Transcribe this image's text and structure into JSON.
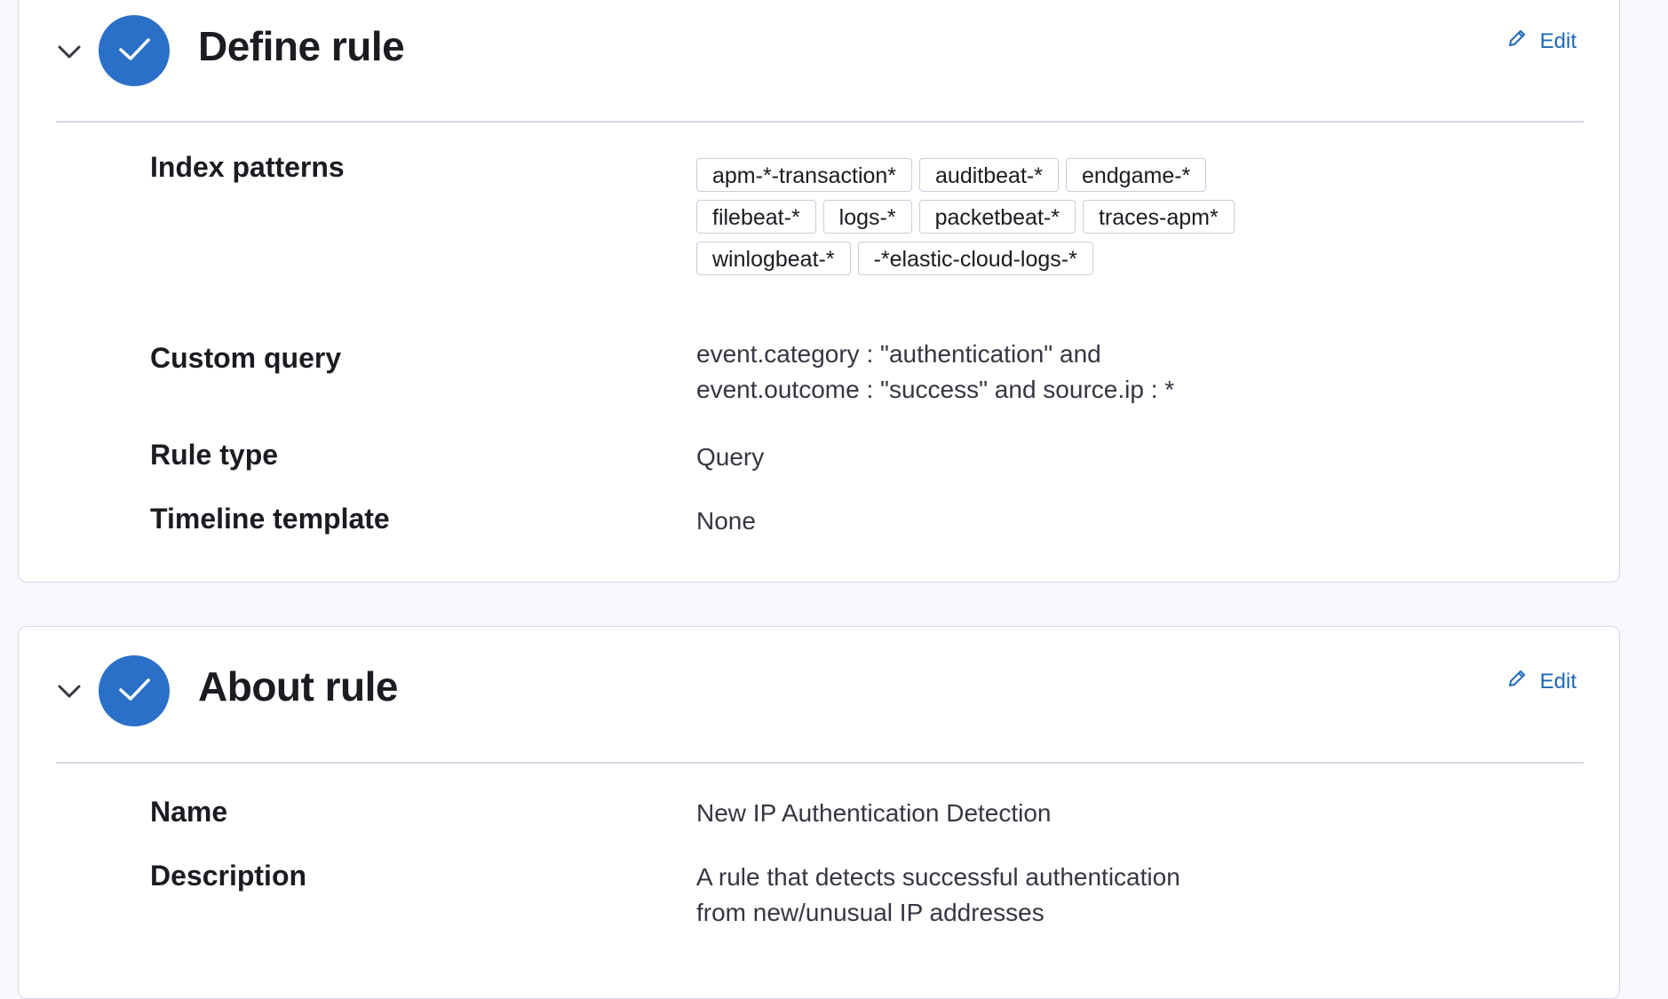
{
  "define_rule": {
    "title": "Define rule",
    "edit_label": "Edit",
    "fields": {
      "index_patterns_label": "Index patterns",
      "index_patterns": [
        "apm-*-transaction*",
        "auditbeat-*",
        "endgame-*",
        "filebeat-*",
        "logs-*",
        "packetbeat-*",
        "traces-apm*",
        "winlogbeat-*",
        "-*elastic-cloud-logs-*"
      ],
      "custom_query_label": "Custom query",
      "custom_query_line1": "event.category : \"authentication\" and",
      "custom_query_line2": "event.outcome : \"success\" and source.ip : *",
      "rule_type_label": "Rule type",
      "rule_type_value": "Query",
      "timeline_template_label": "Timeline template",
      "timeline_template_value": "None"
    }
  },
  "about_rule": {
    "title": "About rule",
    "edit_label": "Edit",
    "fields": {
      "name_label": "Name",
      "name_value": "New IP Authentication Detection",
      "description_label": "Description",
      "description_line1": "A rule that detects successful authentication",
      "description_line2": "from new/unusual IP addresses"
    }
  },
  "colors": {
    "accent": "#2b70c8",
    "link": "#1f69b7",
    "border": "#d3dae6",
    "page_bg": "#f7f8fc"
  },
  "icons": {
    "collapse": "chevron-down-icon",
    "complete": "check-icon",
    "edit": "pencil-icon"
  }
}
